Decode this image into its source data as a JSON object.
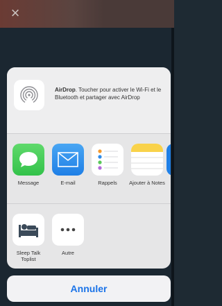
{
  "header": {
    "close_glyph": "×"
  },
  "share": {
    "airdrop": {
      "title": "AirDrop",
      "description": ". Toucher pour activer le Wi-Fi et le Bluetooth et partager avec AirDrop"
    },
    "apps": [
      {
        "label": "Message",
        "icon": "messages-icon"
      },
      {
        "label": "E-mail",
        "icon": "mail-icon"
      },
      {
        "label": "Rappels",
        "icon": "reminders-icon"
      },
      {
        "label": "Ajouter à Notes",
        "icon": "notes-icon"
      }
    ],
    "actions": [
      {
        "label": "Sleep Talk Toplist",
        "icon": "sleep-talk-icon"
      },
      {
        "label": "Autre",
        "icon": "more-icon"
      }
    ],
    "cancel_label": "Annuler"
  },
  "colors": {
    "accent": "#1a73e8",
    "messages_green": "#33c24a",
    "mail_blue": "#1f7fe6",
    "notes_yellow": "#f9d24a"
  }
}
